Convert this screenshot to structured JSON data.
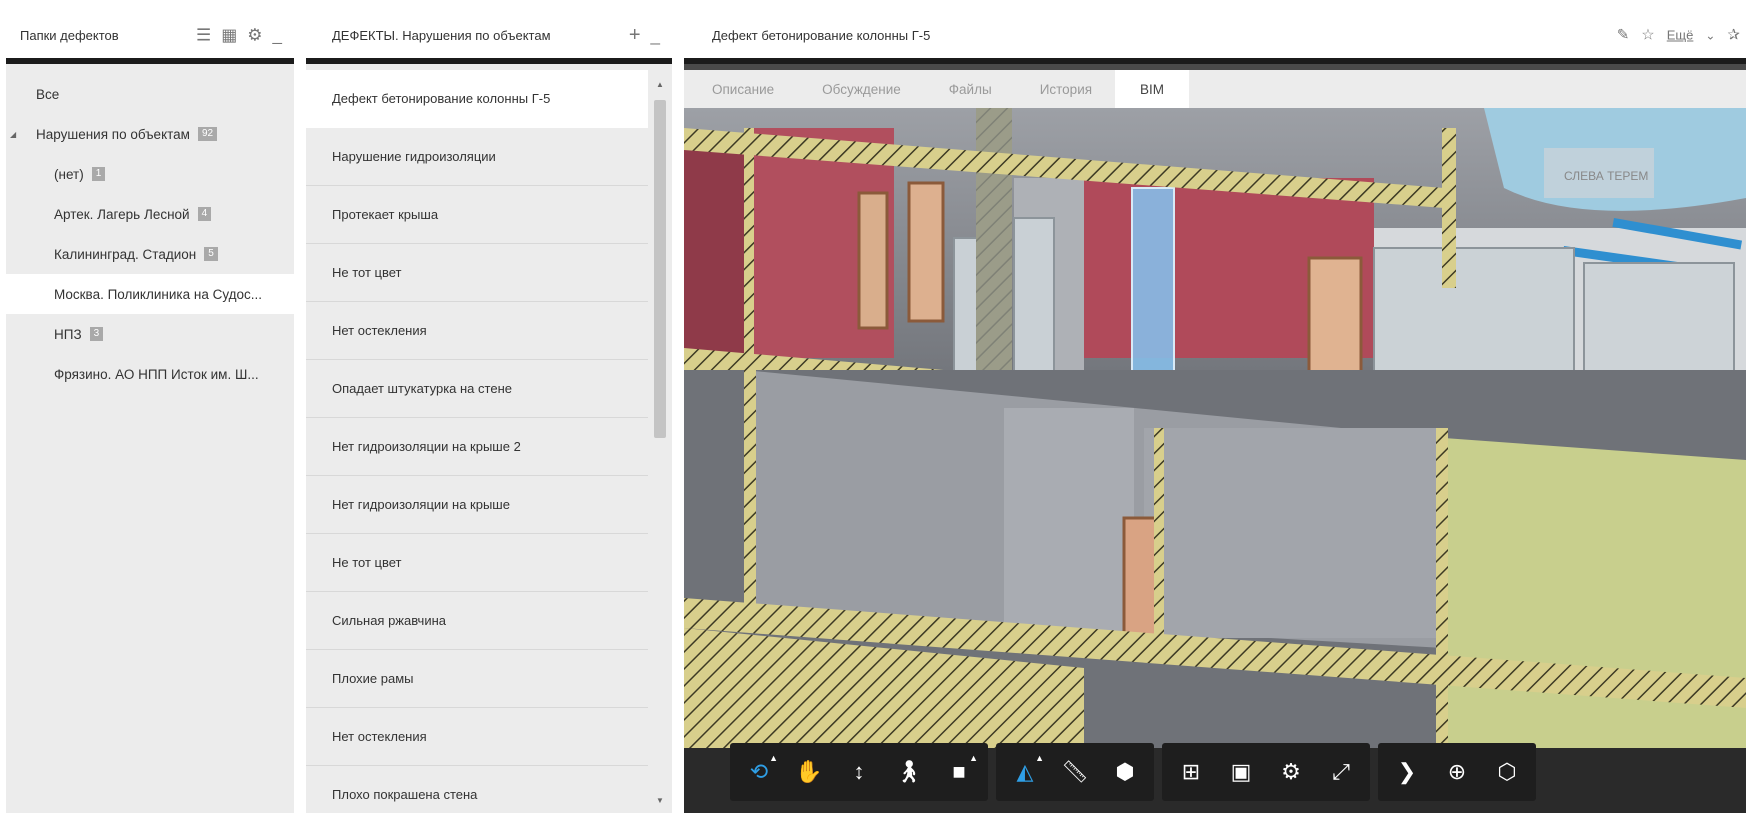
{
  "folders_panel": {
    "title": "Папки дефектов",
    "items": [
      {
        "label": "Все",
        "badge": "",
        "level": 1,
        "arrow": false,
        "selected": false
      },
      {
        "label": "Нарушения по объектам",
        "badge": "92",
        "level": 1,
        "arrow": true,
        "selected": false
      },
      {
        "label": "(нет)",
        "badge": "1",
        "level": 2,
        "arrow": false,
        "selected": false
      },
      {
        "label": "Артек. Лагерь Лесной",
        "badge": "4",
        "level": 2,
        "arrow": false,
        "selected": false
      },
      {
        "label": "Калининград. Стадион",
        "badge": "5",
        "level": 2,
        "arrow": false,
        "selected": false
      },
      {
        "label": "Москва. Поликлиника на Судос...",
        "badge": "",
        "level": 2,
        "arrow": false,
        "selected": true
      },
      {
        "label": "НПЗ",
        "badge": "3",
        "level": 2,
        "arrow": false,
        "selected": false
      },
      {
        "label": "Фрязино. АО НПП Исток им. Ш...",
        "badge": "",
        "level": 2,
        "arrow": false,
        "selected": false
      }
    ]
  },
  "defects_panel": {
    "title": "ДЕФЕКТЫ. Нарушения по объектам",
    "items": [
      {
        "label": "Дефект бетонирование колонны Г-5",
        "selected": true
      },
      {
        "label": "Нарушение гидроизоляции",
        "selected": false
      },
      {
        "label": "Протекает крыша",
        "selected": false
      },
      {
        "label": "Не тот цвет",
        "selected": false
      },
      {
        "label": "Нет остекления",
        "selected": false
      },
      {
        "label": "Опадает штукатурка на стене",
        "selected": false
      },
      {
        "label": "Нет гидроизоляции на крыше 2",
        "selected": false
      },
      {
        "label": "Нет гидроизоляции на крыше",
        "selected": false
      },
      {
        "label": "Не тот цвет",
        "selected": false
      },
      {
        "label": "Сильная ржавчина",
        "selected": false
      },
      {
        "label": "Плохие рамы",
        "selected": false
      },
      {
        "label": "Нет остекления",
        "selected": false
      },
      {
        "label": "Плохо покрашена стена",
        "selected": false
      }
    ]
  },
  "detail_panel": {
    "title": "Дефект бетонирование колонны Г-5",
    "more_label": "Ещё",
    "tabs": [
      "Описание",
      "Обсуждение",
      "Файлы",
      "История",
      "BIM"
    ],
    "active_tab": "BIM",
    "model_sign": "СЛЕВА  ТЕРЕМ"
  },
  "toolbar": {
    "groups": [
      [
        "orbit-icon",
        "pan-hand-icon",
        "zoom-icon",
        "walk-person-icon",
        "camera-icon"
      ],
      [
        "explode-icon",
        "measure-ruler-icon",
        "section-box-icon"
      ],
      [
        "model-browser-icon",
        "properties-icon",
        "settings-gear-icon",
        "fullscreen-icon"
      ],
      [
        "expand-chevron-icon",
        "add-icon",
        "cube-icon"
      ]
    ]
  },
  "colors": {
    "accent": "#2f9fe6",
    "panel_bg": "#ececec",
    "header_bar": "#1b1b1b",
    "toolbar_bg": "#1e1e1e",
    "wall_red": "#b04a5a",
    "wall_green": "#c8cf8d",
    "hatch": "#d9d18a"
  }
}
